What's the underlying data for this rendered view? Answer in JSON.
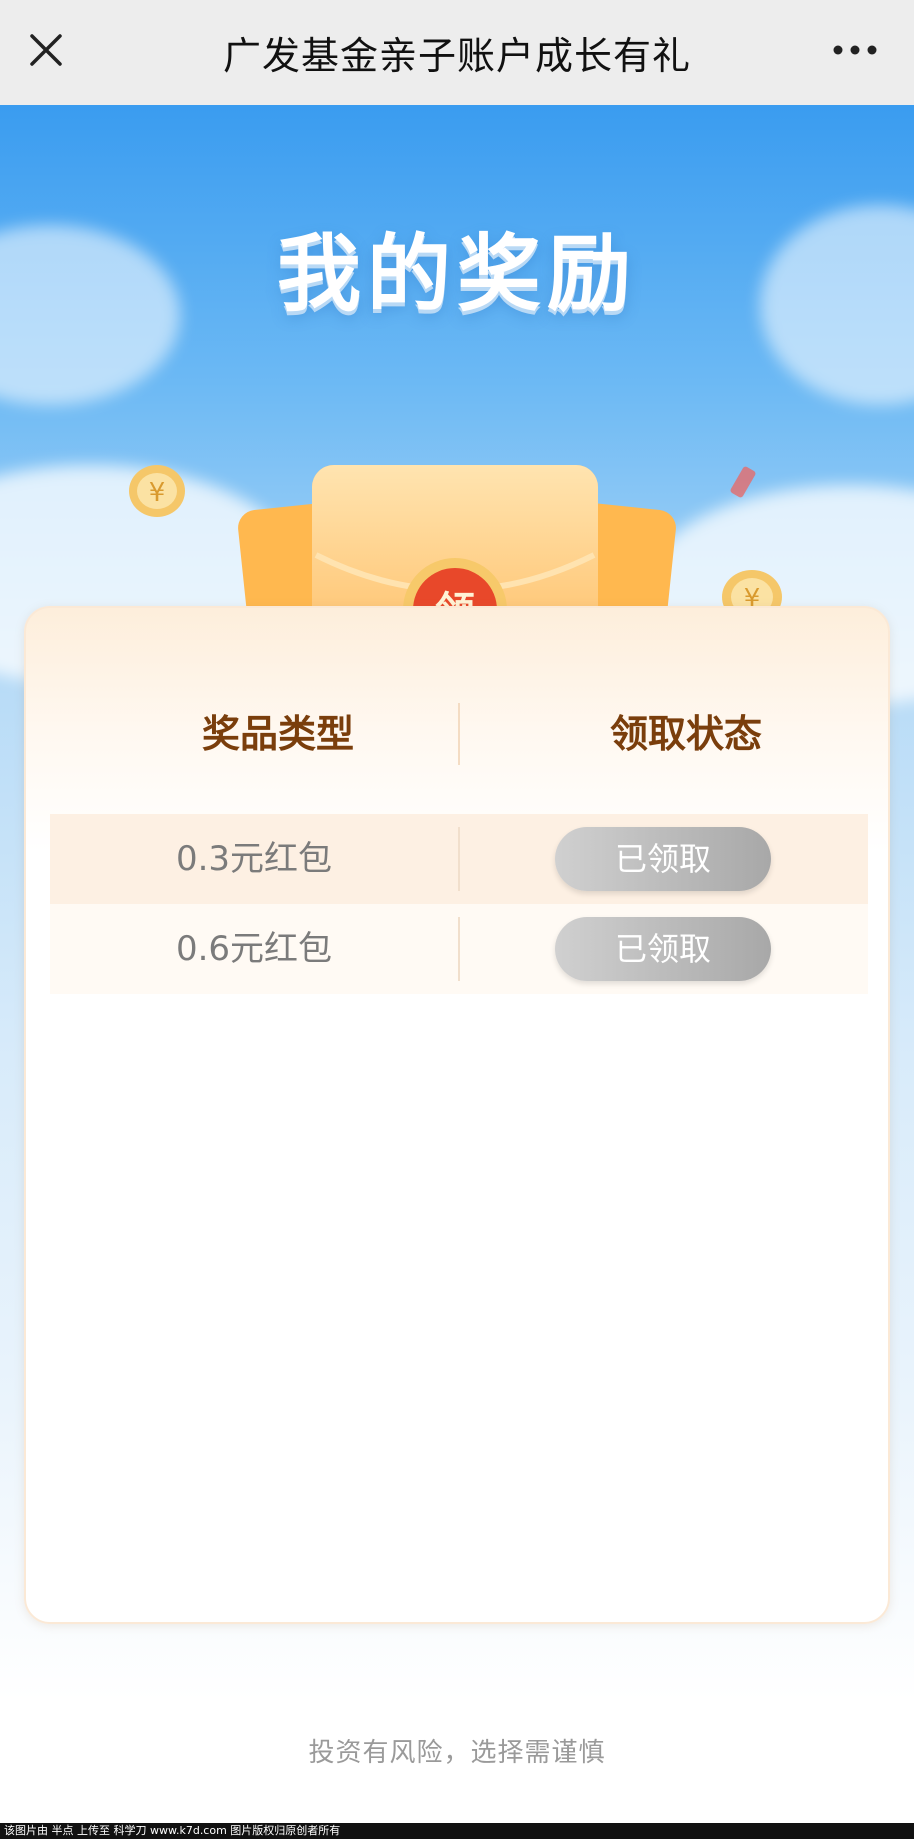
{
  "navbar": {
    "title": "广发基金亲子账户成长有礼",
    "close_icon": "close-icon",
    "more_icon": "more-dots-icon"
  },
  "hero": {
    "title": "我的奖励",
    "seal_text": "领",
    "colors": {
      "sky_top": "#3a9cf0",
      "envelope": "#ffc06b",
      "seal": "#e8482a"
    }
  },
  "rewards": {
    "headers": {
      "type": "奖品类型",
      "status": "领取状态"
    },
    "rows": [
      {
        "type": "0.3元红包",
        "status": "已领取"
      },
      {
        "type": "0.6元红包",
        "status": "已领取"
      }
    ]
  },
  "disclaimer": "投资有风险，选择需谨慎",
  "footer": "该图片由 半点 上传至 科学刀 www.k7d.com 图片版权归原创者所有"
}
